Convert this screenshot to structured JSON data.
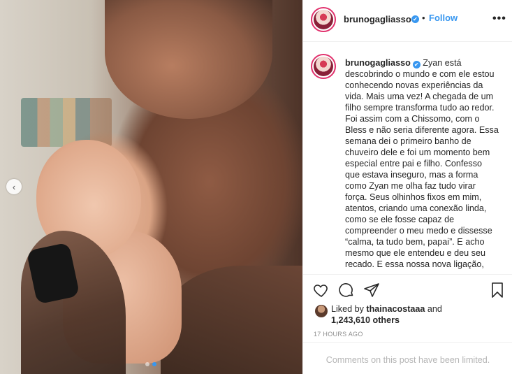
{
  "post": {
    "username": "brunogagliasso",
    "verified_glyph": "✔",
    "follow_label": "Follow",
    "bullet": "•",
    "more_glyph": "•••",
    "caption": "Zyan está descobrindo o mundo e com ele estou conhecendo novas experiências da vida. Mais uma vez! A chegada de um filho sempre transforma tudo ao redor. Foi assim com a Chissomo, com o Bless e não seria diferente agora. Essa semana dei o primeiro banho de chuveiro dele e foi um momento bem especial entre pai e filho. Confesso que estava inseguro, mas a forma como Zyan me olha faz tudo virar força. Seus olhinhos fixos em mim, atentos, criando uma conexão linda, como se ele fosse capaz de compreender o meu medo e dissesse “calma, ta tudo bem, papai”. E acho mesmo que ele entendeu e deu seu recado. E essa nossa nova ligação,"
  },
  "likes": {
    "prefix": "Liked by ",
    "liker": "thainacostaaa",
    "and": " and",
    "others": "1,243,610 others"
  },
  "timestamp": "17 HOURS AGO",
  "comments_notice": "Comments on this post have been limited.",
  "carousel": {
    "prev_glyph": "‹",
    "slide_count": 2,
    "active_index": 1
  },
  "colors": {
    "accent": "#3897f0",
    "text": "#262626",
    "muted": "#8e8e8e",
    "story_ring": "#e1306c"
  },
  "icons": [
    "heart-icon",
    "comment-icon",
    "share-icon",
    "bookmark-icon",
    "chevron-left-icon",
    "more-icon",
    "verified-icon"
  ]
}
